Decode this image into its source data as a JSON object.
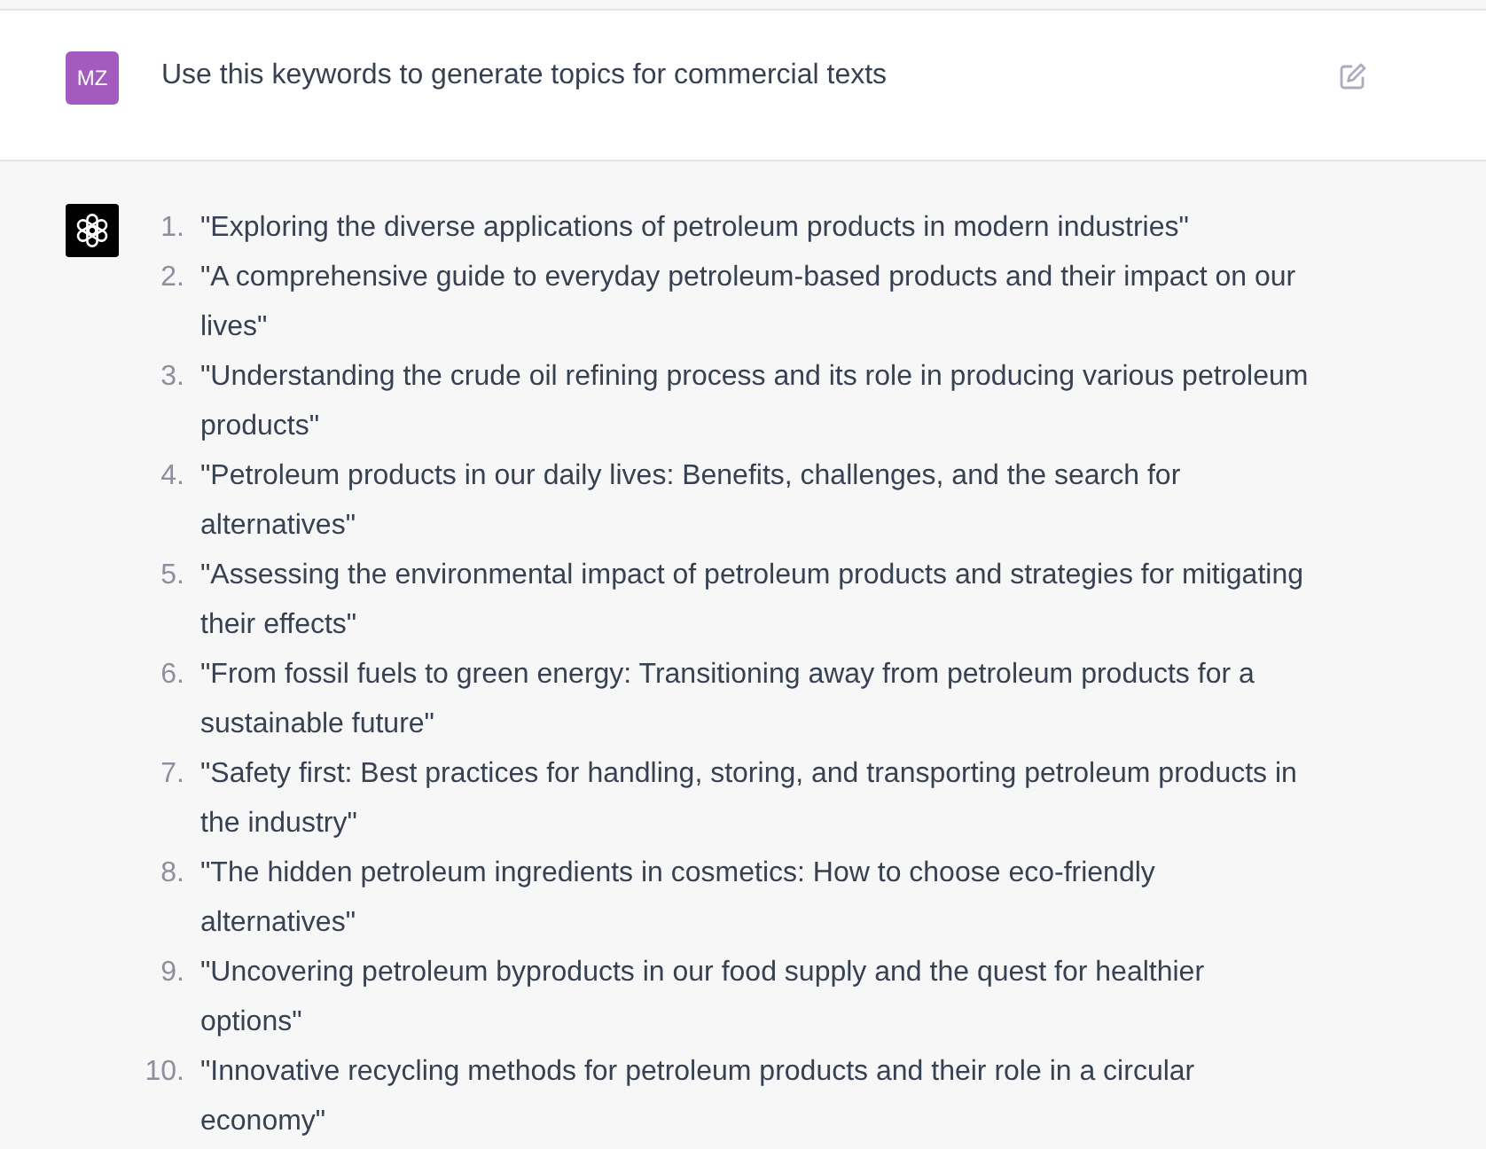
{
  "user_message": {
    "avatar": "MZ",
    "text": "Use this keywords to generate topics for commercial texts"
  },
  "assistant_message": {
    "items": [
      {
        "number": "1.",
        "text": "\"Exploring the diverse applications of petroleum products in modern industries\""
      },
      {
        "number": "2.",
        "text": "\"A comprehensive guide to everyday petroleum-based products and their impact on our lives\""
      },
      {
        "number": "3.",
        "text": "\"Understanding the crude oil refining process and its role in producing various petroleum products\""
      },
      {
        "number": "4.",
        "text": "\"Petroleum products in our daily lives: Benefits, challenges, and the search for alternatives\""
      },
      {
        "number": "5.",
        "text": "\"Assessing the environmental impact of petroleum products and strategies for mitigating their effects\""
      },
      {
        "number": "6.",
        "text": "\"From fossil fuels to green energy: Transitioning away from petroleum products for a sustainable future\""
      },
      {
        "number": "7.",
        "text": "\"Safety first: Best practices for handling, storing, and transporting petroleum products in the industry\""
      },
      {
        "number": "8.",
        "text": "\"The hidden petroleum ingredients in cosmetics: How to choose eco-friendly alternatives\""
      },
      {
        "number": "9.",
        "text": "\"Uncovering petroleum byproducts in our food supply and the quest for healthier options\""
      },
      {
        "number": "10.",
        "text": "\"Innovative recycling methods for petroleum products and their role in a circular economy\""
      }
    ]
  }
}
